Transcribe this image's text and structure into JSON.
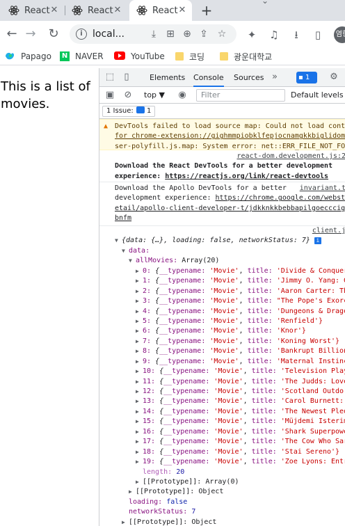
{
  "browser": {
    "tabs": [
      {
        "title": "React"
      },
      {
        "title": "React"
      },
      {
        "title": "React"
      }
    ],
    "address": "local...",
    "profile_initial": "염현",
    "bookmarks": [
      {
        "label": "Papago",
        "icon": "papago-icon"
      },
      {
        "label": "NAVER",
        "icon": "naver-icon"
      },
      {
        "label": "YouTube",
        "icon": "youtube-icon"
      },
      {
        "label": "코딩",
        "icon": "folder-icon"
      },
      {
        "label": "광운대학교",
        "icon": "folder-icon"
      }
    ]
  },
  "page": {
    "text": "This is a list of movies."
  },
  "devtools": {
    "tabs": [
      "Elements",
      "Console",
      "Sources"
    ],
    "active_tab": "Console",
    "issue_count": "1",
    "context": "top ▼",
    "filter_placeholder": "Filter",
    "levels": "Default levels ▼",
    "issues_label": "1 Issue:",
    "issues_count": "1",
    "messages": {
      "warning_lines": [
        "DevTools failed to load source map: Could not load conte",
        "for chrome-extension://gighmmpiobklfepjocnamgkkbiglidom/",
        "ser-polyfill.js.map: System error: net::ERR_FILE_NOT_FOU"
      ],
      "react_src": "react-dom.development.js:2",
      "react_line1": "Download the React DevTools for a better development",
      "react_line2_prefix": "experience: ",
      "react_line2_link": "https://reactjs.org/link/react-devtools",
      "apollo_src": "invariant.t",
      "apollo_line1": "Download the Apollo DevTools for a better",
      "apollo_line2_prefix": "development experience: ",
      "apollo_line2_link": "https://chrome.google.com/websto",
      "apollo_line3": "etail/apollo-client-developer-t/jdkknkkbebbapilgoecccigl",
      "apollo_line4": "bnfm",
      "client_src": "client.j"
    },
    "object": {
      "summary": "{data: {…}, loading: false, networkStatus: 7}",
      "data_key": "data:",
      "allMovies_key": "allMovies:",
      "allMovies_type": "Array(20)",
      "movies": [
        {
          "index": "0",
          "title": "'Divide & Conquer"
        },
        {
          "index": "1",
          "title": "'Jimmy O. Yang: G"
        },
        {
          "index": "2",
          "title": "'Aaron Carter: Th"
        },
        {
          "index": "3",
          "title": "\"The Pope's Exorc"
        },
        {
          "index": "4",
          "title": "'Dungeons & Drago"
        },
        {
          "index": "5",
          "title": "'Renfield'}"
        },
        {
          "index": "6",
          "title": "'Knor'}"
        },
        {
          "index": "7",
          "title": "'Koning Worst'}"
        },
        {
          "index": "8",
          "title": "'Bankrupt Billion"
        },
        {
          "index": "9",
          "title": "'Maternal Instinc"
        },
        {
          "index": "10",
          "title": "'Television Play"
        },
        {
          "index": "11",
          "title": "'The Judds: Love"
        },
        {
          "index": "12",
          "title": "'Scotland Outdo"
        },
        {
          "index": "13",
          "title": "'Carol Burnett:"
        },
        {
          "index": "14",
          "title": "'The Newest Pled"
        },
        {
          "index": "15",
          "title": "'Müjdemi Isterim"
        },
        {
          "index": "16",
          "title": "'Shark Superpowe"
        },
        {
          "index": "17",
          "title": "'The Cow Who Sar"
        },
        {
          "index": "18",
          "title": "'Stai Sereno'}"
        },
        {
          "index": "19",
          "title": "'Zoe Lyons: Entr"
        }
      ],
      "typename_key": "__typename:",
      "typename_val": "'Movie'",
      "title_key": "title:",
      "length_key": "length:",
      "length_val": "20",
      "proto_array_key": "[[Prototype]]:",
      "proto_array_val": "Array(0)",
      "proto_obj_key": "[[Prototype]]:",
      "proto_obj_val": "Object",
      "loading_key": "loading:",
      "loading_val": "false",
      "network_key": "networkStatus:",
      "network_val": "7",
      "proto_root_key": "[[Prototype]]:",
      "proto_root_val": "Object"
    }
  }
}
